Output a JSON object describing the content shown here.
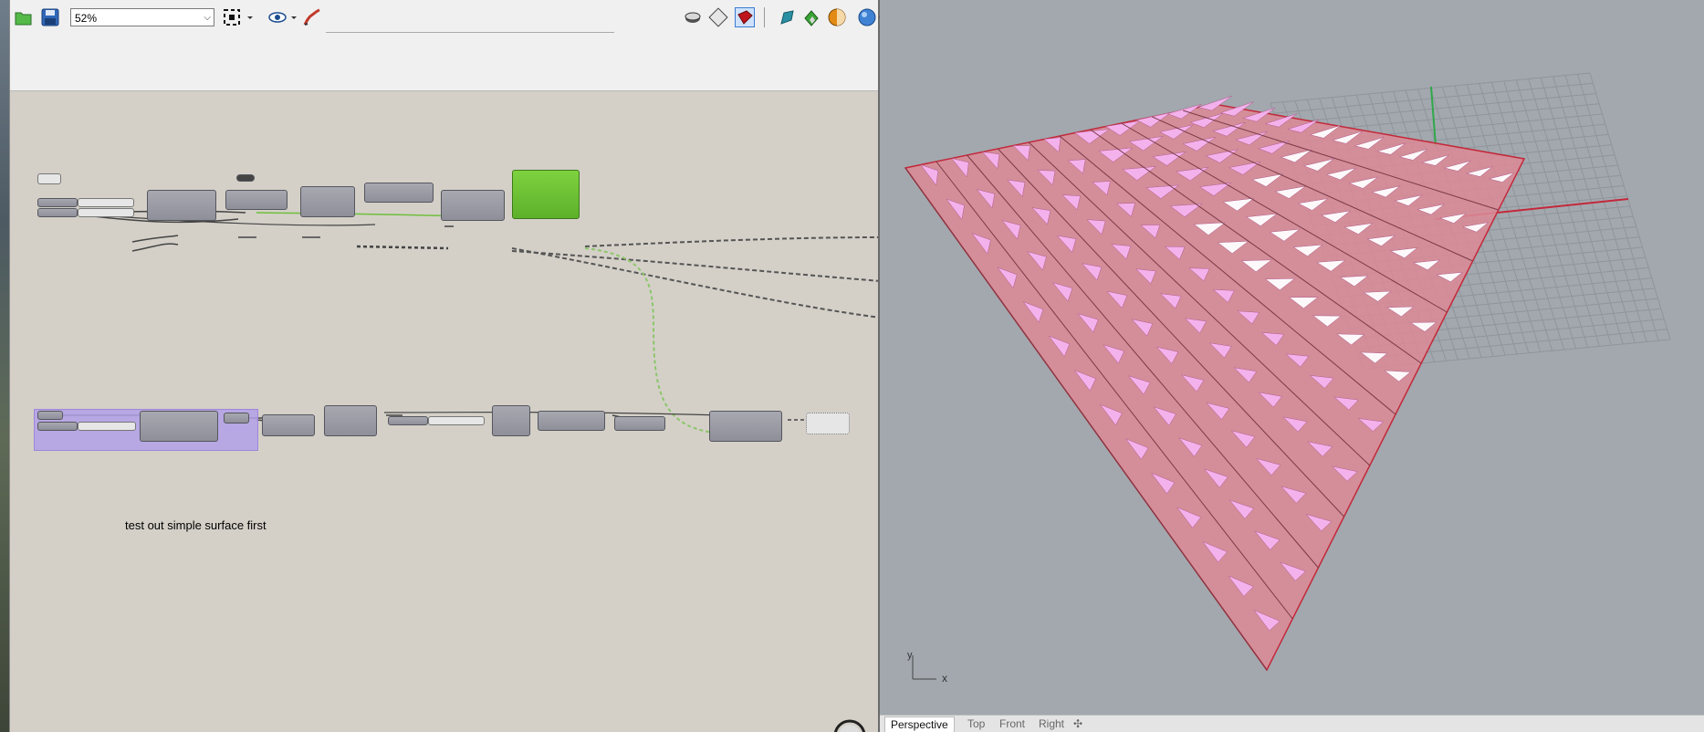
{
  "toolbar": {
    "zoom_value": "52%",
    "zoom_dropdown_glyph": "⌵",
    "icons": [
      "open-file-icon",
      "save-icon",
      "zoom-extents-icon",
      "preview-icon",
      "sketch-icon",
      "preview-wireframe-icon",
      "preview-shaded-icon",
      "preview-selected-icon",
      "bake-icon",
      "gradient-icon",
      "material-icon",
      "sphere-icon"
    ]
  },
  "canvas": {
    "note": "test out simple surface first"
  },
  "rhino": {
    "axis_y": "y",
    "axis_x": "x",
    "tabs": [
      {
        "label": "Perspective",
        "active": true
      },
      {
        "label": "Top",
        "active": false
      },
      {
        "label": "Front",
        "active": false
      },
      {
        "label": "Right",
        "active": false
      }
    ],
    "add_tab_glyph": "✣",
    "colors": {
      "surface": "#d98a96",
      "edge": "#c3283a",
      "fin": "#f6b4f0",
      "grid": "#8f959b"
    }
  }
}
